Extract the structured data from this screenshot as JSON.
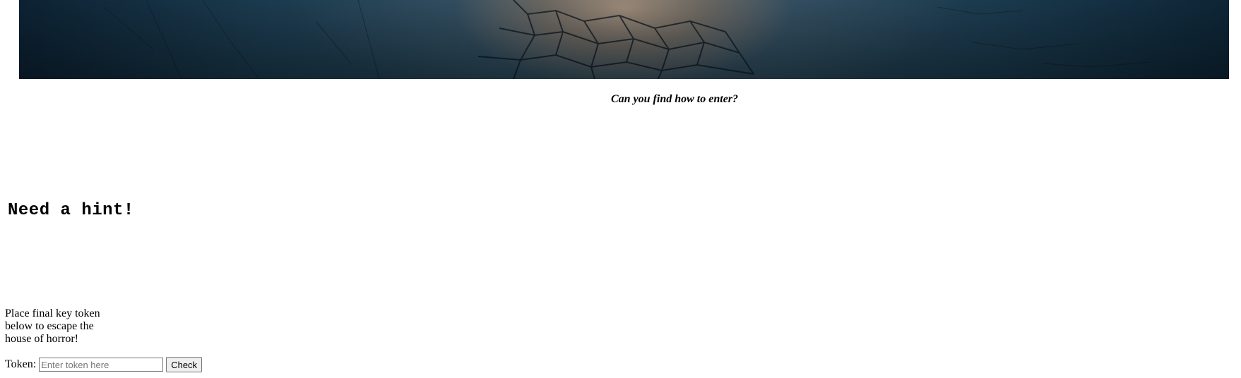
{
  "banner": {
    "description_icon": "cracked-stone-path-image"
  },
  "tagline": "Can you find how to enter?",
  "hint": {
    "heading": "Need a hint!"
  },
  "escape_form": {
    "instructions": "Place final key token below to escape the house of horror!",
    "token_label": "Token:",
    "token_placeholder": "Enter token here",
    "token_value": "",
    "check_label": "Check"
  }
}
